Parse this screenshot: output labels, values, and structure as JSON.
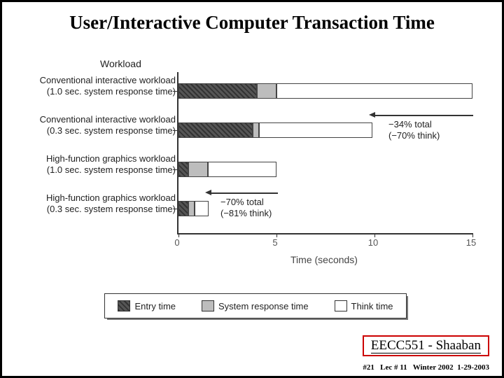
{
  "title": "User/Interactive Computer Transaction Time",
  "workload_heading": "Workload",
  "ylabels": [
    "Conventional interactive workload\n(1.0 sec. system response time)",
    "Conventional interactive workload\n(0.3 sec. system response time)",
    "High-function graphics workload\n(1.0 sec. system response time)",
    "High-function graphics workload\n(0.3 sec. system response time)"
  ],
  "xticks": [
    "0",
    "5",
    "10",
    "15"
  ],
  "xlabel": "Time (seconds)",
  "legend": {
    "entry": "Entry time",
    "system": "System response time",
    "think": "Think time"
  },
  "annot1_line1": "−34% total",
  "annot1_line2": "(−70% think)",
  "annot2_line1": "−70% total",
  "annot2_line2": "(−81% think)",
  "author": "EECC551 - Shaaban",
  "footer_slide": "#21",
  "footer_lec": "Lec # 11",
  "footer_term": "Winter 2002",
  "footer_date": "1-29-2003",
  "chart_data": {
    "type": "bar",
    "orientation": "horizontal",
    "stacked": true,
    "title": "User/Interactive Computer Transaction Time",
    "xlabel": "Time (seconds)",
    "ylabel": "Workload",
    "xlim": [
      0,
      15
    ],
    "categories": [
      "Conventional interactive workload (1.0 sec. system response time)",
      "Conventional interactive workload (0.3 sec. system response time)",
      "High-function graphics workload (1.0 sec. system response time)",
      "High-function graphics workload (0.3 sec. system response time)"
    ],
    "series": [
      {
        "name": "Entry time",
        "values": [
          4.0,
          3.8,
          0.5,
          0.5
        ]
      },
      {
        "name": "System response time",
        "values": [
          1.0,
          0.3,
          1.0,
          0.3
        ]
      },
      {
        "name": "Think time",
        "values": [
          10.0,
          5.8,
          3.5,
          0.7
        ]
      }
    ],
    "annotations": [
      {
        "target_category_index": 1,
        "text": "−34% total (−70% think)"
      },
      {
        "target_category_index": 3,
        "text": "−70% total (−81% think)"
      }
    ],
    "legend_position": "bottom",
    "grid": false
  }
}
